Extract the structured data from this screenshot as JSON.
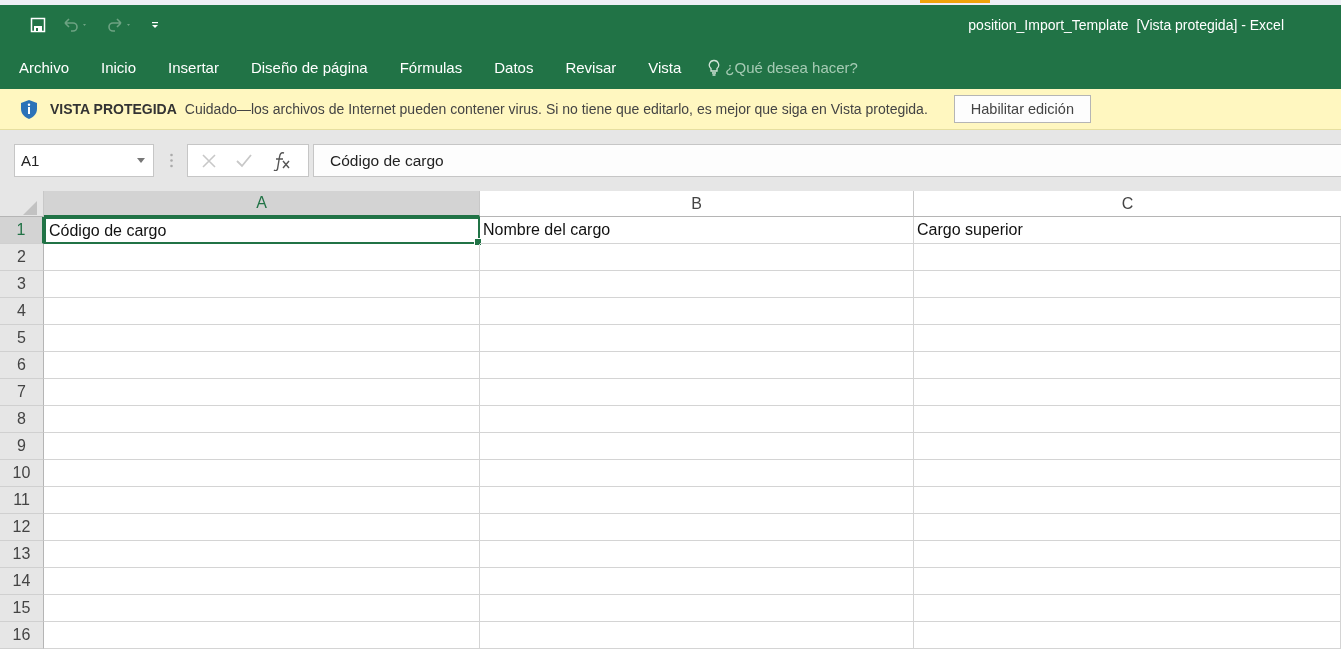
{
  "window": {
    "title": "position_Import_Template  [Vista protegida] - Excel"
  },
  "quick_access": [
    {
      "kind": "save",
      "disabled": false
    },
    {
      "kind": "undo",
      "disabled": true
    },
    {
      "kind": "redo",
      "disabled": true
    },
    {
      "kind": "customize",
      "disabled": false
    }
  ],
  "ribbon_tabs": [
    "Archivo",
    "Inicio",
    "Insertar",
    "Diseño de página",
    "Fórmulas",
    "Datos",
    "Revisar",
    "Vista"
  ],
  "tell_me": {
    "placeholder": "¿Qué desea hacer?"
  },
  "protected_bar": {
    "title": "VISTA PROTEGIDA",
    "message": "Cuidado—los archivos de Internet pueden contener virus. Si no tiene que editarlo, es mejor que siga en Vista protegida.",
    "button": "Habilitar edición"
  },
  "formula_bar": {
    "name_box": "A1",
    "value": "Código de cargo"
  },
  "columns": [
    {
      "label": "A",
      "selected": true
    },
    {
      "label": "B",
      "selected": false
    },
    {
      "label": "C",
      "selected": false
    }
  ],
  "rows": [
    {
      "header": "1",
      "selected": true,
      "cells": [
        {
          "text": "Código de cargo",
          "selected": true
        },
        {
          "text": "Nombre del cargo",
          "selected": false
        },
        {
          "text": "Cargo superior",
          "selected": false
        }
      ]
    },
    {
      "header": "2",
      "selected": false
    },
    {
      "header": "3",
      "selected": false
    },
    {
      "header": "4",
      "selected": false
    },
    {
      "header": "5",
      "selected": false
    },
    {
      "header": "6",
      "selected": false
    },
    {
      "header": "7",
      "selected": false
    },
    {
      "header": "8",
      "selected": false
    },
    {
      "header": "9",
      "selected": false
    },
    {
      "header": "10",
      "selected": false
    },
    {
      "header": "11",
      "selected": false
    },
    {
      "header": "12",
      "selected": false
    },
    {
      "header": "13",
      "selected": false
    },
    {
      "header": "14",
      "selected": false
    },
    {
      "header": "15",
      "selected": false
    },
    {
      "header": "16",
      "selected": false
    }
  ]
}
